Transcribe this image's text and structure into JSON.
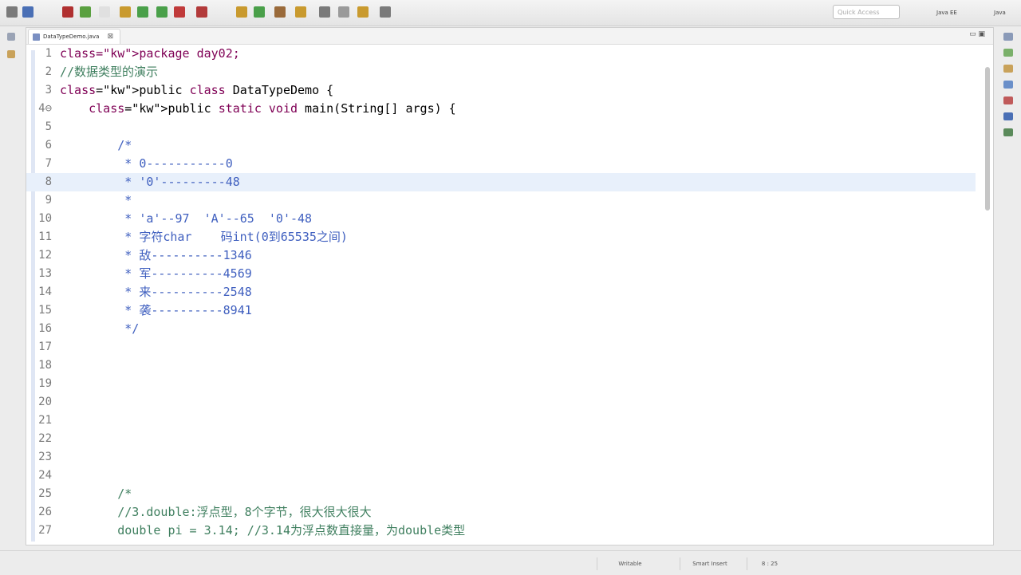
{
  "toolbar": {
    "quick_access_placeholder": "Quick Access",
    "perspectives": [
      "Java EE",
      "Java"
    ],
    "colors": [
      "#7a7a7a",
      "#4a6fb5",
      "#b03030",
      "#5aa040",
      "#e0e0e0",
      "#c99a2e",
      "#4aa04a",
      "#4aa04a",
      "#c03a3a",
      "#b23a3a",
      "#c99a2e",
      "#4aa04a",
      "#9a6a3a",
      "#c99a2e",
      "#7a7a7a",
      "#9a9a9a",
      "#c99a2e",
      "#7a7a7a"
    ]
  },
  "editor": {
    "tab_label": "DataTypeDemo.java",
    "tab_close": "⊠",
    "minmax": "▭ ▣",
    "highlighted_line": 8,
    "lines": [
      {
        "n": "1",
        "text": "package day02;",
        "cls": "kw"
      },
      {
        "n": "2",
        "text": "//数据类型的演示",
        "cls": "cm"
      },
      {
        "n": "3",
        "text": "public class DataTypeDemo {",
        "cls": ""
      },
      {
        "n": "4⊖",
        "text": "    public static void main(String[] args) {",
        "cls": ""
      },
      {
        "n": "5",
        "text": "",
        "cls": ""
      },
      {
        "n": "6",
        "text": "        /*",
        "cls": "jd"
      },
      {
        "n": "7",
        "text": "         * 0-----------0",
        "cls": "jd"
      },
      {
        "n": "8",
        "text": "         * '0'---------48",
        "cls": "jd"
      },
      {
        "n": "9",
        "text": "         *",
        "cls": "jd"
      },
      {
        "n": "10",
        "text": "         * 'a'--97  'A'--65  '0'-48",
        "cls": "jd"
      },
      {
        "n": "11",
        "text": "         * 字符char    码int(0到65535之间)",
        "cls": "jd"
      },
      {
        "n": "12",
        "text": "         * 敌----------1346",
        "cls": "jd"
      },
      {
        "n": "13",
        "text": "         * 军----------4569",
        "cls": "jd"
      },
      {
        "n": "14",
        "text": "         * 来----------2548",
        "cls": "jd"
      },
      {
        "n": "15",
        "text": "         * 袭----------8941",
        "cls": "jd"
      },
      {
        "n": "16",
        "text": "         */",
        "cls": "jd"
      },
      {
        "n": "17",
        "text": "",
        "cls": ""
      },
      {
        "n": "18",
        "text": "",
        "cls": ""
      },
      {
        "n": "19",
        "text": "",
        "cls": ""
      },
      {
        "n": "20",
        "text": "",
        "cls": ""
      },
      {
        "n": "21",
        "text": "",
        "cls": ""
      },
      {
        "n": "22",
        "text": "",
        "cls": ""
      },
      {
        "n": "23",
        "text": "",
        "cls": ""
      },
      {
        "n": "24",
        "text": "",
        "cls": ""
      },
      {
        "n": "25",
        "text": "        /*",
        "cls": "cm"
      },
      {
        "n": "26",
        "text": "        //3.double:浮点型，8个字节，很大很大很大",
        "cls": "cm"
      },
      {
        "n": "27",
        "text": "        double pi = 3.14; //3.14为浮点数直接量，为double类型",
        "cls": "cm"
      }
    ]
  },
  "status": {
    "writable": "Writable",
    "insert_mode": "Smart Insert",
    "position": "8 : 25"
  }
}
